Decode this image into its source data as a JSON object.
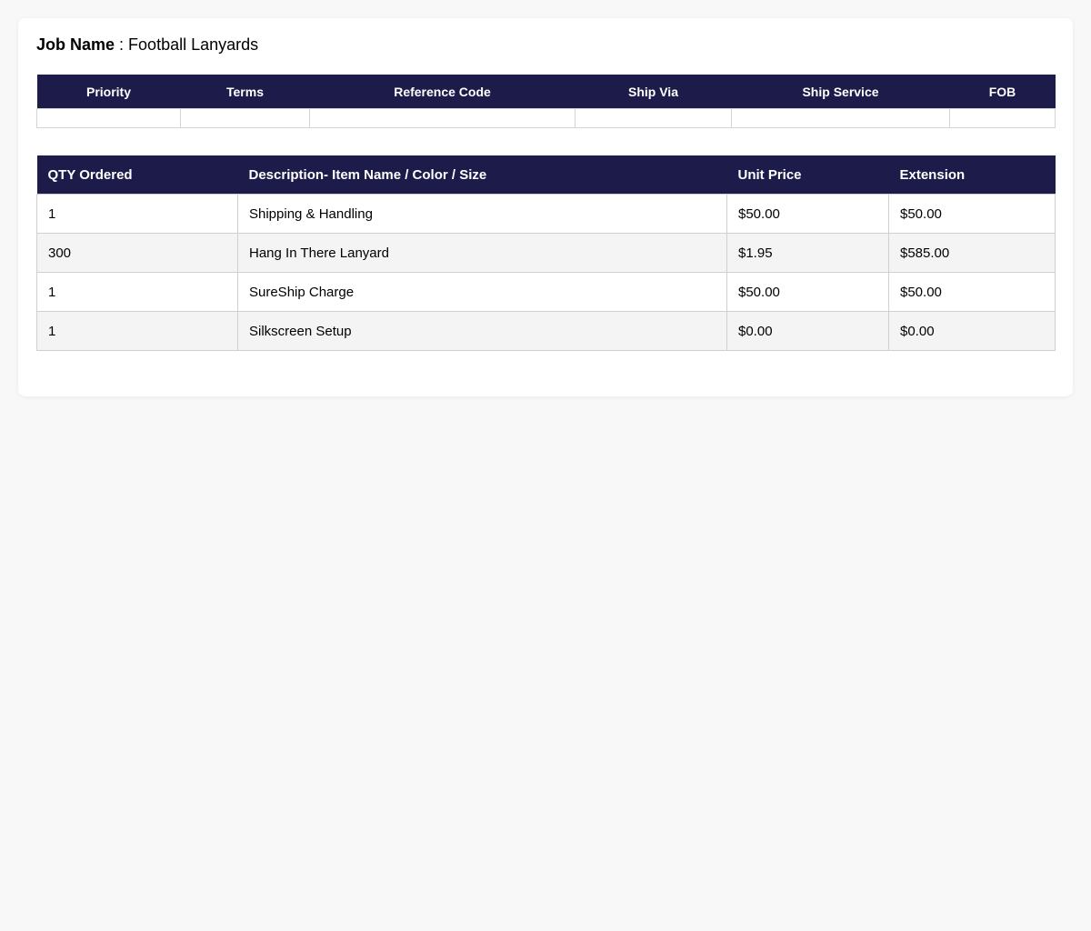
{
  "job": {
    "label": "Job Name",
    "separator": " : ",
    "value": "Football Lanyards"
  },
  "meta_table": {
    "headers": [
      "Priority",
      "Terms",
      "Reference Code",
      "Ship Via",
      "Ship Service",
      "FOB"
    ],
    "values": [
      "",
      "",
      "",
      "",
      "",
      ""
    ]
  },
  "items_table": {
    "headers": [
      "QTY Ordered",
      "Description- Item Name / Color / Size",
      "Unit Price",
      "Extension"
    ],
    "rows": [
      [
        "1",
        "Shipping & Handling",
        "$50.00",
        "$50.00"
      ],
      [
        "300",
        "Hang In There Lanyard",
        "$1.95",
        "$585.00"
      ],
      [
        "1",
        "SureShip Charge",
        "$50.00",
        "$50.00"
      ],
      [
        "1",
        "Silkscreen Setup",
        "$0.00",
        "$0.00"
      ]
    ]
  },
  "colors": {
    "header_bg": "#1c1b4a",
    "header_text": "#ffffff",
    "stripe_bg": "#f4f4f4",
    "page_bg": "#f8f8f8"
  }
}
